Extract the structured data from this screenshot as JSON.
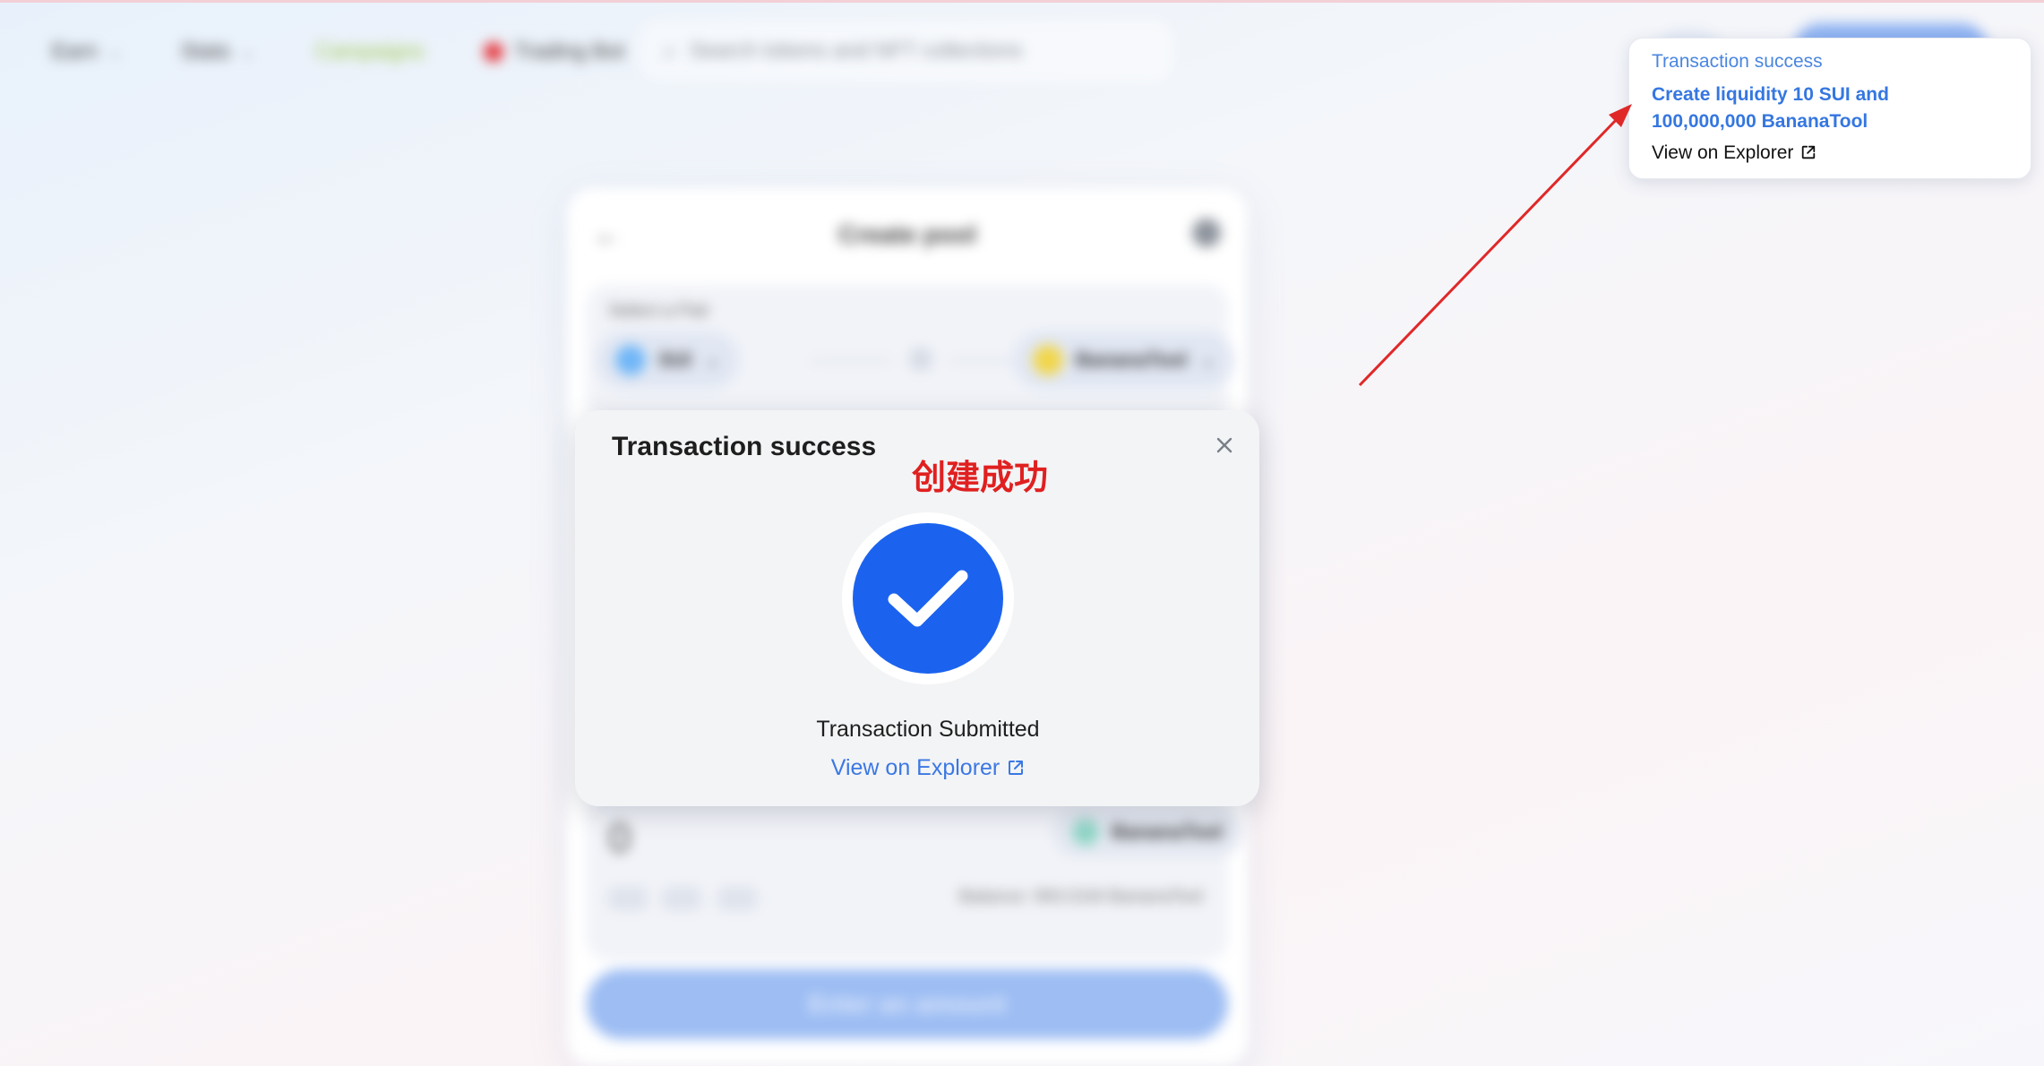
{
  "nav": {
    "earn": "Earn",
    "stats": "Stats",
    "campaigns": "Campaigns",
    "trading_bot": "Trading Bot",
    "search_placeholder": "Search tokens and NFT collections"
  },
  "card": {
    "title": "Create pool",
    "select_pair_label": "Select a Pair",
    "token_a": "SUI",
    "token_b": "BananaTool",
    "amount_value": "0",
    "amount_token": "BananaTool",
    "chips": [
      "25%",
      "50%",
      "Max"
    ],
    "balance": "Balance: 993.01M BananaTool",
    "cta": "Enter an amount"
  },
  "modal": {
    "title": "Transaction success",
    "annotation": "创建成功",
    "submitted": "Transaction Submitted",
    "explorer_link": "View on Explorer"
  },
  "toast": {
    "title": "Transaction success",
    "description": "Create liquidity 10 SUI and 100,000,000 BananaTool",
    "explorer_link": "View on Explorer"
  },
  "colors": {
    "primary_blue": "#1b63ef",
    "link_blue": "#3b78e3",
    "annotation_red": "#e02020"
  },
  "icons": [
    "search-icon",
    "back-arrow-icon",
    "settings-icon",
    "check-icon",
    "close-icon",
    "external-link-icon",
    "chevron-down-icon"
  ]
}
